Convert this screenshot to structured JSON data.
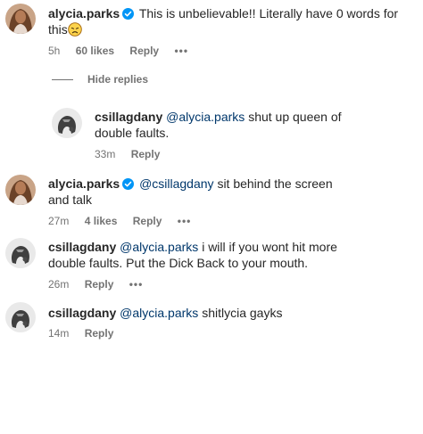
{
  "comments": [
    {
      "username": "alycia.parks",
      "verified": true,
      "text": "This is unbelievable!! Literally have 0 words for this",
      "emoji": "disappointed-face",
      "time": "5h",
      "likes": "60 likes",
      "reply": "Reply",
      "more": "•••"
    },
    {
      "username": "csillagdany",
      "mention": "@alycia.parks",
      "text": "shut up queen of double faults.",
      "time": "33m",
      "reply": "Reply"
    },
    {
      "username": "alycia.parks",
      "verified": true,
      "mention": "@csillagdany",
      "text": "sit behind the screen and talk",
      "time": "27m",
      "likes": "4 likes",
      "reply": "Reply",
      "more": "•••"
    },
    {
      "username": "csillagdany",
      "mention": "@alycia.parks",
      "text": "i will if you wont hit more double faults. Put the Dick Back to your mouth.",
      "time": "26m",
      "reply": "Reply",
      "more": "•••"
    },
    {
      "username": "csillagdany",
      "mention": "@alycia.parks",
      "text": "shitlycia gayks",
      "time": "14m",
      "reply": "Reply"
    }
  ],
  "hide_replies": "Hide replies",
  "colors": {
    "text": "#262626",
    "secondary": "#737373",
    "mention": "#00376b",
    "verified": "#0095f6"
  },
  "icons": {
    "verified": "verified-badge-icon",
    "emoji": "disappointed-face"
  }
}
